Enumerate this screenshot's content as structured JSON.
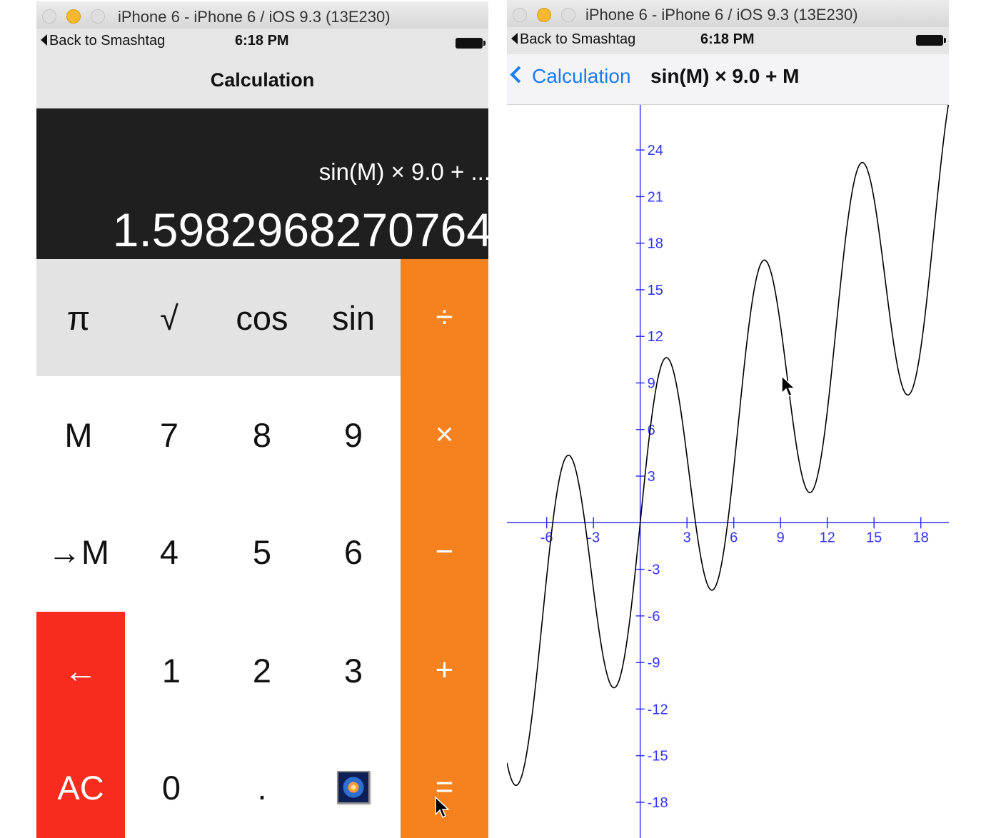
{
  "left_window": {
    "title": "iPhone 6 - iPhone 6 / iOS 9.3 (13E230)",
    "status": {
      "back_label": "Back to Smashtag",
      "time": "6:18 PM"
    },
    "nav_title": "Calculation",
    "display": {
      "description": "sin(M) × 9.0 + ...",
      "result": "1.5982968270764"
    },
    "keys": {
      "pi": "π",
      "sqrt": "√",
      "cos": "cos",
      "sin": "sin",
      "divide": "÷",
      "m": "M",
      "seven": "7",
      "eight": "8",
      "nine": "9",
      "multiply": "×",
      "set_m": "→M",
      "four": "4",
      "five": "5",
      "six": "6",
      "minus": "−",
      "backspace": "←",
      "one": "1",
      "two": "2",
      "three": "3",
      "plus": "+",
      "clear": "AC",
      "zero": "0",
      "decimal": ".",
      "equals": "="
    },
    "colors": {
      "operator": "#f6821f",
      "clear": "#f82b1f",
      "function_row": "#e3e3e3",
      "display": "#1f1f1f"
    }
  },
  "right_window": {
    "title": "iPhone 6 - iPhone 6 / iOS 9.3 (13E230)",
    "status": {
      "back_label": "Back to Smashtag",
      "time": "6:18 PM"
    },
    "nav_back_label": "Calculation",
    "nav_title": "sin(M) × 9.0 + M",
    "colors": {
      "axes": "#3333ff",
      "curve": "#000000",
      "nav_link": "#1a7cf5"
    },
    "graph": {
      "type": "line",
      "function": "sin(M) × 9.0 + M",
      "x_ticks": [
        "-6",
        "-3",
        "3",
        "6",
        "9",
        "12",
        "15",
        "18"
      ],
      "y_ticks": [
        "24",
        "21",
        "18",
        "15",
        "12",
        "9",
        "6",
        "3",
        "-3",
        "-6",
        "-9",
        "-12",
        "-15",
        "-18"
      ],
      "x_range": [
        -8.55,
        19.8
      ],
      "y_range": [
        -20.3,
        26.9
      ]
    }
  },
  "chart_data": {
    "type": "line",
    "title": "sin(M) × 9.0 + M",
    "series": [
      {
        "expression": "9*sin(x) + x"
      }
    ],
    "x_ticks": [
      -6,
      -3,
      3,
      6,
      9,
      12,
      15,
      18
    ],
    "y_ticks": [
      24,
      21,
      18,
      15,
      12,
      9,
      6,
      3,
      -3,
      -6,
      -9,
      -12,
      -15,
      -18
    ],
    "xlim": [
      -8.55,
      19.8
    ],
    "ylim": [
      -20.3,
      26.9
    ],
    "grid": false
  }
}
